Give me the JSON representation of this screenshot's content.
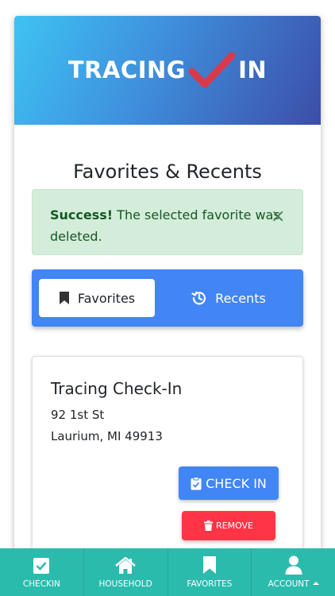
{
  "header": {
    "logo_left": "TRACING",
    "logo_right": "IN",
    "logo_check_color": "#d93a4b"
  },
  "page": {
    "title": "Favorites & Recents"
  },
  "alert": {
    "strong": "Success!",
    "message": " The selected favorite was deleted.",
    "close_glyph": "×"
  },
  "tabs": [
    {
      "label": "Favorites",
      "icon": "bookmark-icon",
      "active": true
    },
    {
      "label": "Recents",
      "icon": "history-icon",
      "active": false
    }
  ],
  "favorites": [
    {
      "name": "Tracing Check-In",
      "address_line1": "92 1st St",
      "address_line2": "Laurium, MI 49913",
      "checkin_label": "CHECK IN",
      "remove_label": "REMOVE"
    }
  ],
  "bottom_nav": [
    {
      "label": "CHECKIN",
      "icon": "checkbox-icon"
    },
    {
      "label": "HOUSEHOLD",
      "icon": "home-icon"
    },
    {
      "label": "FAVORITES",
      "icon": "bookmark-icon"
    },
    {
      "label": "ACCOUNT",
      "icon": "user-icon"
    }
  ],
  "colors": {
    "primary": "#4285f4",
    "success_bg": "#d4edda",
    "success_text": "#155724",
    "danger": "#ff3547",
    "nav": "#2bbbad"
  }
}
